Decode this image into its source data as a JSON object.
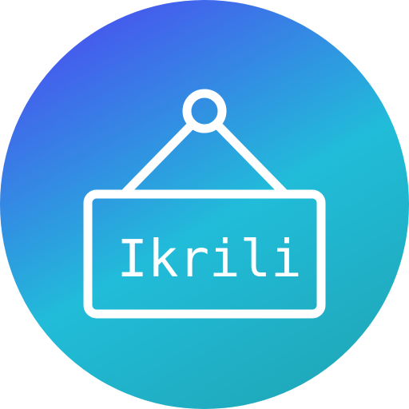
{
  "sign": {
    "text": "Ikrili"
  },
  "colors": {
    "gradient_start": "#4a4ef0",
    "gradient_mid": "#21bcd9",
    "gradient_end": "#1fa7b8",
    "stroke": "#ffffff"
  },
  "icons": {
    "sign": "hanging-sign-icon"
  }
}
